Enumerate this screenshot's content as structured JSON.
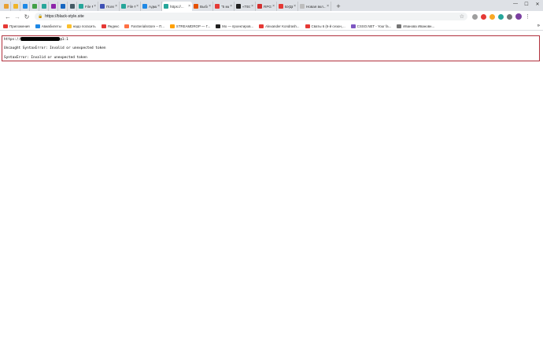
{
  "tabs": [
    {
      "label": "",
      "color": "#e8a033",
      "pinned": true
    },
    {
      "label": "",
      "color": "#f0b429",
      "pinned": true
    },
    {
      "label": "",
      "color": "#1e88e5",
      "pinned": true
    },
    {
      "label": "",
      "color": "#43a047",
      "pinned": true
    },
    {
      "label": "",
      "color": "#26a69a",
      "pinned": true
    },
    {
      "label": "",
      "color": "#8e24aa",
      "pinned": true
    },
    {
      "label": "",
      "color": "#1565c0",
      "pinned": true
    },
    {
      "label": "",
      "color": "#455a64",
      "pinned": true
    },
    {
      "label": "File M...",
      "color": "#26a69a",
      "pinned": false
    },
    {
      "label": "Полезн...",
      "color": "#3f51b5",
      "pinned": false
    },
    {
      "label": "File M...",
      "color": "#26a69a",
      "pinned": false
    },
    {
      "label": "Админ...",
      "color": "#1e88e5",
      "pinned": false
    },
    {
      "label": "https://...",
      "color": "#26a69a",
      "pinned": false,
      "active": true
    },
    {
      "label": "Выбор...",
      "color": "#e65100",
      "pinned": false
    },
    {
      "label": "\"5 мин...",
      "color": "#e53935",
      "pinned": false
    },
    {
      "label": "«ТЕСН...",
      "color": "#212121",
      "pinned": false
    },
    {
      "label": "RPG-С...",
      "color": "#d32f2f",
      "pinned": false
    },
    {
      "label": "БУДЬ...",
      "color": "#e53935",
      "pinned": false
    },
    {
      "label": "Новая вкл...",
      "color": "#bdbdbd",
      "pinned": false
    }
  ],
  "new_tab_label": "+",
  "window_controls": {
    "minimize": "—",
    "maximize": "☐",
    "close": "✕"
  },
  "toolbar": {
    "url": "https://black-style.site",
    "back": "←",
    "forward": "→",
    "reload": "↻",
    "lock": "🔒",
    "star": "☆",
    "menu": "⋮"
  },
  "bookmarks": [
    {
      "label": "Приложения",
      "color": "#e53935"
    },
    {
      "label": "Авиабилеты",
      "color": "#1e88e5"
    },
    {
      "label": "надо погасить",
      "color": "#fbc02d"
    },
    {
      "label": "Яндекс",
      "color": "#e53935"
    },
    {
      "label": "FanSerialsstore – П...",
      "color": "#ff7043"
    },
    {
      "label": "STREAMDROP — Г...",
      "color": "#ffa000"
    },
    {
      "label": "Mo — проектиров...",
      "color": "#212121"
    },
    {
      "label": "Alexander Kondrash...",
      "color": "#e53935"
    },
    {
      "label": "Сваты 6 (6-й сезон,...",
      "color": "#e53935"
    },
    {
      "label": "CSSO.NET - Your fa...",
      "color": "#7e57c2"
    },
    {
      "label": "Иванова Ивановн...",
      "color": "#757575"
    }
  ],
  "bookmarks_overflow": "»",
  "page": {
    "url_prefix": "https://",
    "url_suffix": "@1:1",
    "error1": "Uncaught SyntaxError: Invalid or unexpected token",
    "error2": "SyntaxError: Invalid or unexpected token"
  }
}
